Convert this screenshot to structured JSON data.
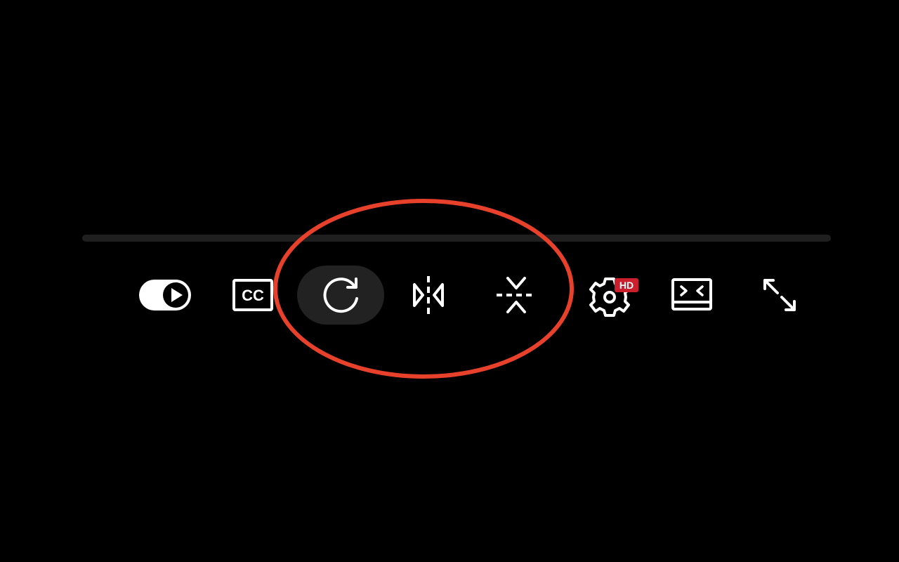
{
  "player": {
    "background": "#000000",
    "progress": {
      "played_fraction": 0,
      "track_color": "#1f1f1f",
      "fill_color": "#1f1f1f"
    },
    "controls": [
      {
        "id": "autoplay",
        "icon": "autoplay-toggle-icon",
        "state": "on"
      },
      {
        "id": "captions",
        "icon": "closed-captions-icon",
        "glyph": "CC"
      },
      {
        "id": "rotate",
        "icon": "rotate-icon",
        "hovered": true
      },
      {
        "id": "mirror",
        "icon": "flip-horizontal-icon"
      },
      {
        "id": "collapse",
        "icon": "collapse-vertical-icon"
      },
      {
        "id": "settings",
        "icon": "gear-icon",
        "badge": "HD"
      },
      {
        "id": "theater",
        "icon": "theater-mode-icon"
      },
      {
        "id": "fullscreen",
        "icon": "fullscreen-icon"
      }
    ],
    "settings_badge": "HD",
    "captions_label": "CC",
    "colors": {
      "icon": "#ffffff",
      "hover_bg": "#222222",
      "badge_bg": "#cc1f2e",
      "annotation": "#e8412b"
    }
  }
}
